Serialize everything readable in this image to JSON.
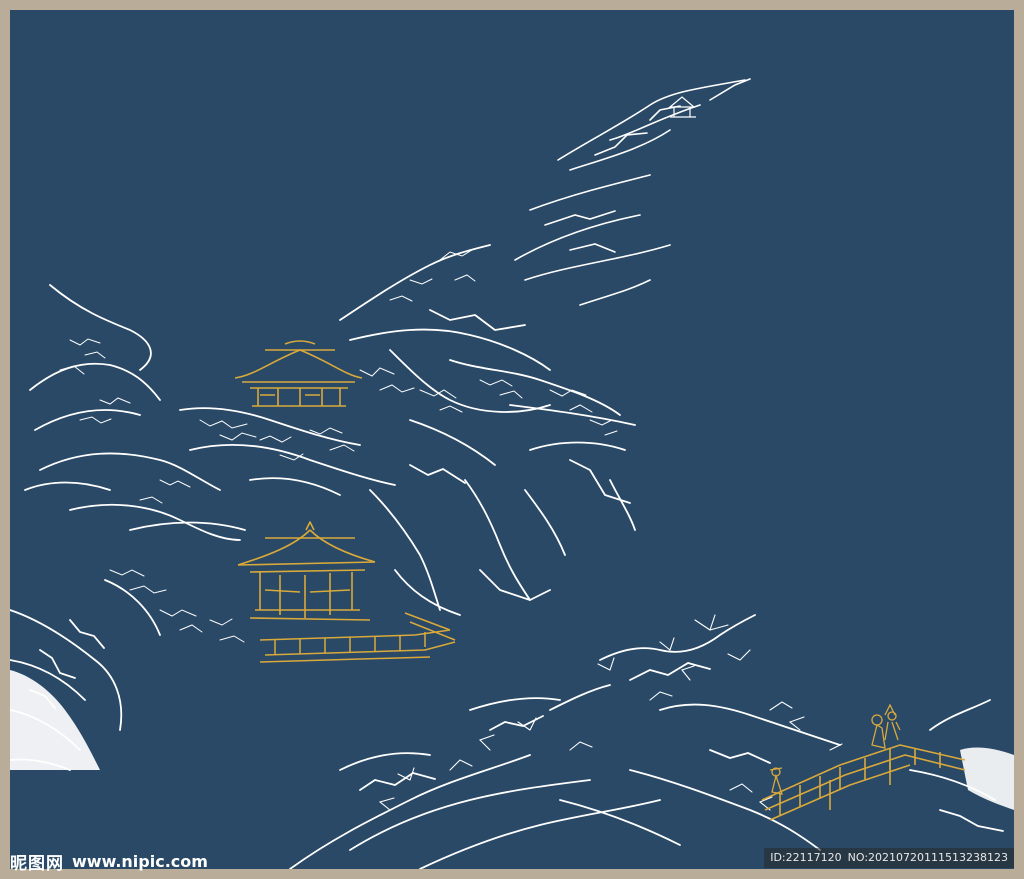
{
  "artwork": {
    "background_color": "#294966",
    "frame_color": "#b9ac98",
    "snow_color": "#ffffff",
    "gold_color": "#d9a93b"
  },
  "watermark": {
    "logo_text": "昵图网",
    "site_url": "www.nipic.com",
    "image_id": "ID:22117120",
    "image_no": "NO:20210720111513238123"
  }
}
